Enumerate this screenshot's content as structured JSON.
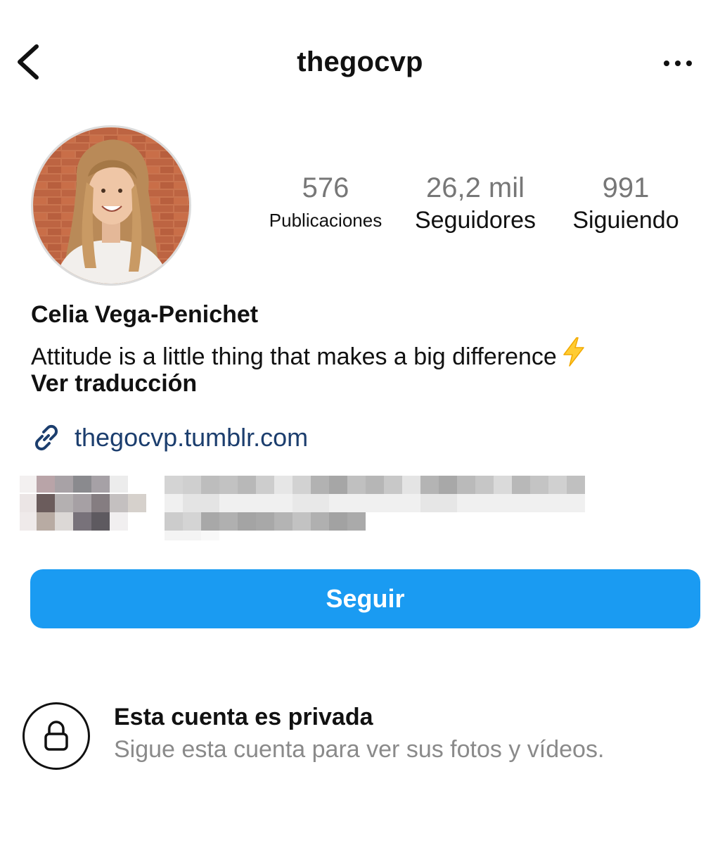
{
  "header": {
    "back_icon": "chevron-left-icon",
    "username": "thegocvp",
    "more_icon": "ellipsis-horizontal-icon"
  },
  "profile": {
    "avatar_icon": "profile-photo",
    "full_name": "Celia Vega-Penichet",
    "bio": "Attitude is a little thing that makes a big difference",
    "bio_emoji_icon": "lightning-bolt-icon",
    "translate_label": "Ver traducción",
    "link_icon": "link-icon",
    "link": "thegocvp.tumblr.com",
    "link_color": "#1c3e6e"
  },
  "stats": {
    "posts": {
      "value": "576",
      "label": "Publicaciones"
    },
    "followers": {
      "value": "26,2 mil",
      "label": "Seguidores"
    },
    "following": {
      "value": "991",
      "label": "Siguiendo"
    }
  },
  "follow_button": {
    "label": "Seguir",
    "color": "#1a9bf2"
  },
  "private_notice": {
    "lock_icon": "lock-icon",
    "title": "Esta cuenta es privada",
    "subtitle": "Sigue esta cuenta para ver sus fotos y vídeos."
  }
}
